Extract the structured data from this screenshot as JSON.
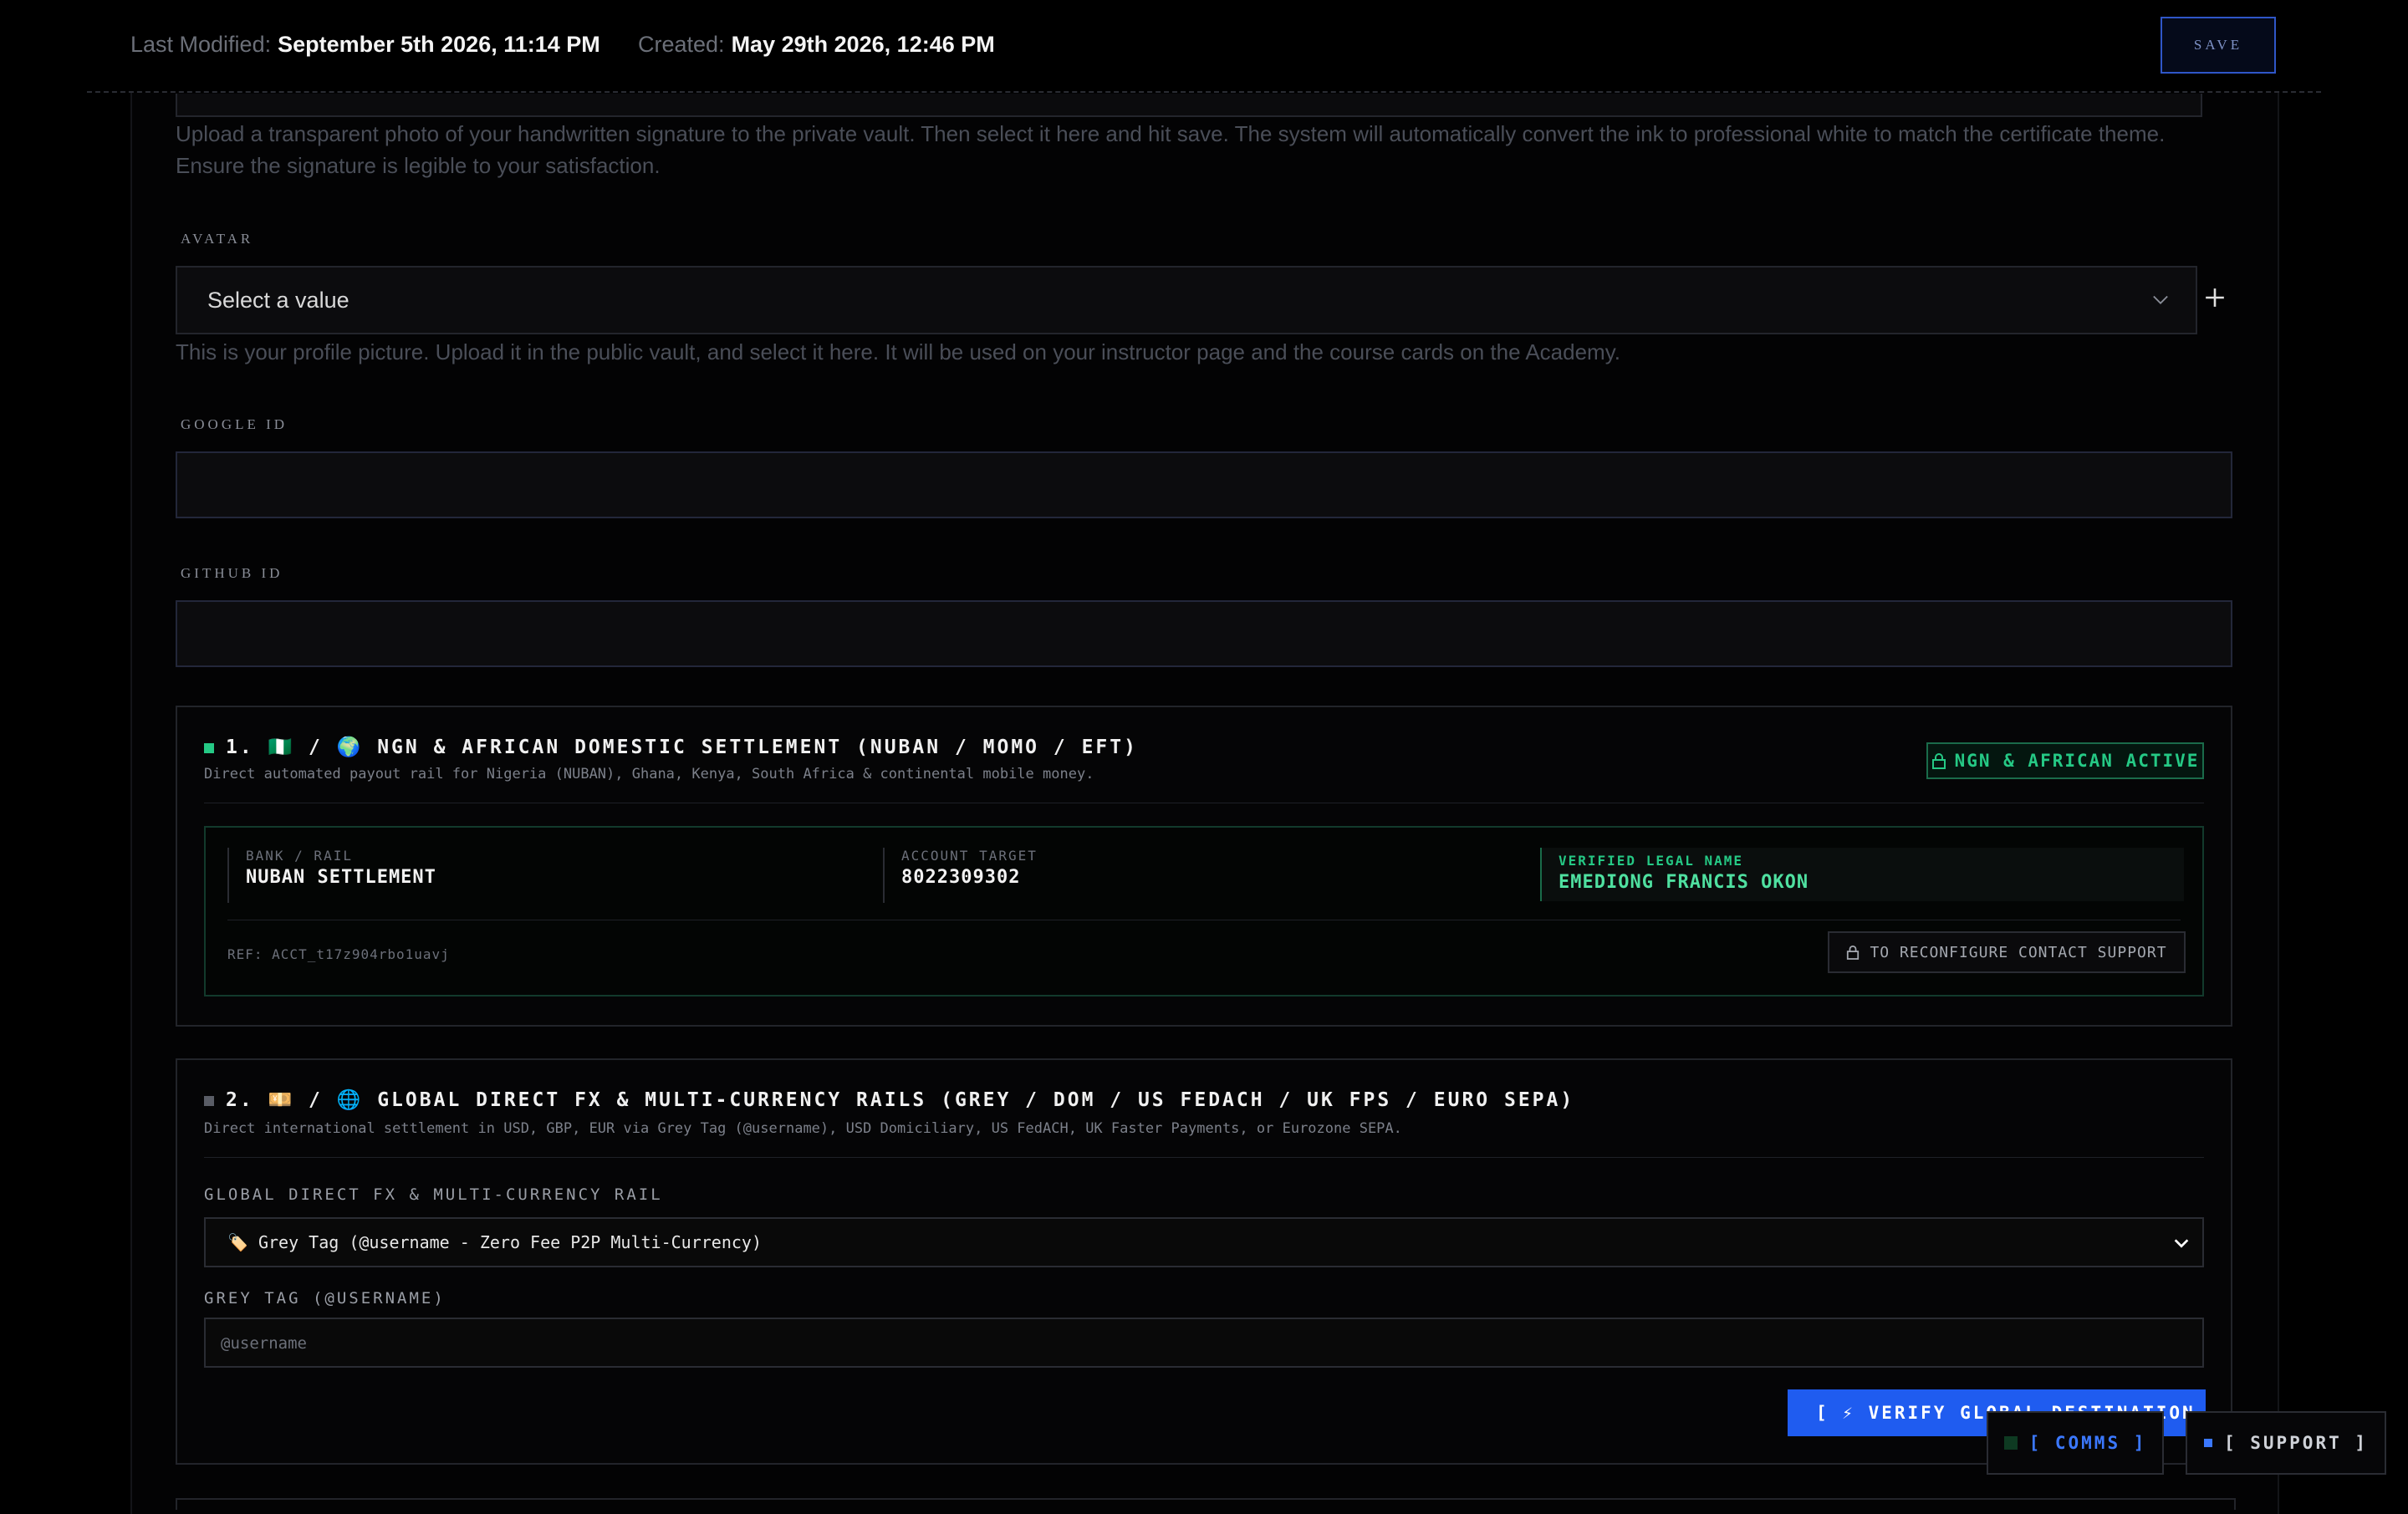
{
  "header": {
    "last_modified_label": "Last Modified:",
    "last_modified_value": "September 5th 2026, 11:14 PM",
    "created_label": "Created:",
    "created_value": "May 29th 2026, 12:46 PM",
    "save_label": "SAVE"
  },
  "signature": {
    "help": "Upload a transparent photo of your handwritten signature to the private vault. Then select it here and hit save. The system will automatically convert the ink to professional white to match the certificate theme. Ensure the signature is legible to your satisfaction."
  },
  "avatar": {
    "label": "AVATAR",
    "select_value": "Select a value",
    "add_icon": "plus-icon",
    "help": "This is your profile picture. Upload it in the public vault, and select it here. It will be used on your instructor page and the course cards on the Academy."
  },
  "google": {
    "label": "GOOGLE ID",
    "value": ""
  },
  "github": {
    "label": "GITHUB ID",
    "value": ""
  },
  "rail1": {
    "title": "1. 🇳🇬 / 🌍 NGN & AFRICAN DOMESTIC SETTLEMENT (NUBAN / MOMO / EFT)",
    "subtitle": "Direct automated payout rail for Nigeria (NUBAN), Ghana, Kenya, South Africa & continental mobile money.",
    "badge": "NGN & AFRICAN ACTIVE",
    "bank_label": "BANK / RAIL",
    "bank_value": "NUBAN SETTLEMENT",
    "account_label": "ACCOUNT TARGET",
    "account_value": "8022309302",
    "verified_label": "VERIFIED LEGAL NAME",
    "verified_value": "EMEDIONG FRANCIS OKON",
    "ref": "REF: ACCT_t17z904rbo1uavj",
    "reconfigure": "TO RECONFIGURE CONTACT SUPPORT",
    "accent": "#25c985"
  },
  "rail2": {
    "title": "2. 💴 / 🌐 GLOBAL DIRECT FX & MULTI-CURRENCY RAILS (GREY / DOM / US FEDACH / UK FPS / EURO SEPA)",
    "subtitle": "Direct international settlement in USD, GBP, EUR via Grey Tag (@username), USD Domiciliary, US FedACH, UK Faster Payments, or Eurozone SEPA.",
    "rail_label": "GLOBAL DIRECT FX & MULTI-CURRENCY RAIL",
    "rail_value": "🏷️ Grey Tag (@username - Zero Fee P2P Multi-Currency)",
    "tag_label": "GREY TAG (@USERNAME)",
    "tag_placeholder": "@username",
    "verify_button": "[ ⚡ VERIFY GLOBAL DESTINATION ]",
    "accent": "#1f5cf0"
  },
  "floating": {
    "comms": "[ COMMS ]",
    "support": "[ SUPPORT ]"
  }
}
